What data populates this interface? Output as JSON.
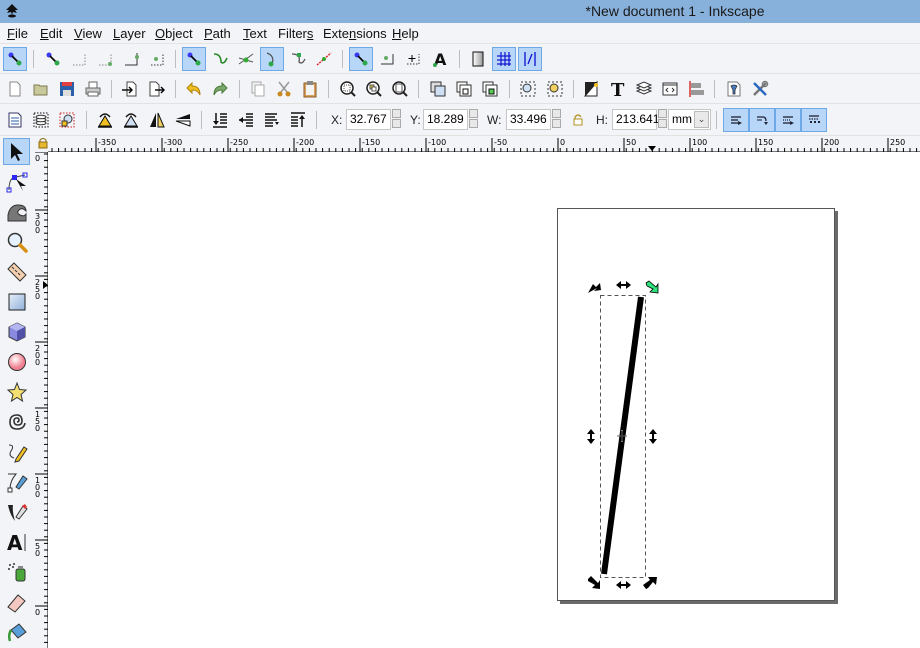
{
  "window": {
    "title": "*New document 1 - Inkscape",
    "app_icon": "inkscape-logo-icon"
  },
  "menu": [
    {
      "label": "File",
      "mnemonic": "F"
    },
    {
      "label": "Edit",
      "mnemonic": "E"
    },
    {
      "label": "View",
      "mnemonic": "V"
    },
    {
      "label": "Layer",
      "mnemonic": "L"
    },
    {
      "label": "Object",
      "mnemonic": "O"
    },
    {
      "label": "Path",
      "mnemonic": "P"
    },
    {
      "label": "Text",
      "mnemonic": "T"
    },
    {
      "label": "Filters",
      "mnemonic": "s"
    },
    {
      "label": "Extensions",
      "mnemonic": "n"
    },
    {
      "label": "Help",
      "mnemonic": "H"
    }
  ],
  "snap_toolbar": {
    "items": [
      {
        "icon": "snap-enable-icon",
        "active": true
      },
      {
        "icon": "snap-bbox-icon",
        "active": false
      },
      {
        "icon": "snap-bbox-edge-icon",
        "active": false
      },
      {
        "icon": "snap-bbox-corner-icon",
        "active": false
      },
      {
        "icon": "snap-bbox-midpoint-icon",
        "active": false
      },
      {
        "icon": "snap-bbox-center-icon",
        "active": false
      },
      {
        "icon": "snap-nodes-icon",
        "active": true
      },
      {
        "icon": "snap-path-icon",
        "active": false
      },
      {
        "icon": "snap-path-intersection-icon",
        "active": false
      },
      {
        "icon": "snap-cusp-nodes-icon",
        "active": true
      },
      {
        "icon": "snap-smooth-nodes-icon",
        "active": false
      },
      {
        "icon": "snap-line-midpoint-icon",
        "active": false
      },
      {
        "icon": "snap-others-icon",
        "active": true
      },
      {
        "icon": "snap-object-center-icon",
        "active": false
      },
      {
        "icon": "snap-rotation-center-icon",
        "active": false
      },
      {
        "icon": "snap-text-baseline-icon",
        "active": false
      },
      {
        "icon": "snap-page-border-icon",
        "active": false
      },
      {
        "icon": "snap-grid-icon",
        "active": true
      },
      {
        "icon": "snap-guide-icon",
        "active": true
      }
    ]
  },
  "commands_toolbar": {
    "items": [
      "new-document-icon",
      "open-icon",
      "save-icon",
      "print-icon",
      "import-icon",
      "export-icon",
      "undo-icon",
      "redo-icon",
      "copy-icon",
      "cut-icon",
      "paste-icon",
      "zoom-selection-icon",
      "zoom-drawing-icon",
      "zoom-page-icon",
      "duplicate-icon",
      "clone-icon",
      "unlink-clone-icon",
      "group-icon",
      "ungroup-icon",
      "fill-stroke-icon",
      "text-font-icon",
      "layers-icon",
      "xml-editor-icon",
      "align-distribute-icon",
      "document-properties-icon",
      "preferences-icon"
    ]
  },
  "select_toolbar": {
    "buttons": [
      "select-all-icon",
      "select-all-layers-icon",
      "deselect-icon",
      "rotate-ccw-icon",
      "rotate-cw-icon",
      "flip-horizontal-icon",
      "flip-vertical-icon",
      "lower-to-bottom-icon",
      "lower-icon",
      "raise-icon",
      "raise-to-top-icon"
    ],
    "x": {
      "label": "X:",
      "value": "32.767"
    },
    "y": {
      "label": "Y:",
      "value": "18.289"
    },
    "w": {
      "label": "W:",
      "value": "33.496"
    },
    "h": {
      "label": "H:",
      "value": "213.641"
    },
    "lock_icon": "lock-icon",
    "unit": "mm",
    "transform_toggles": [
      {
        "icon": "scale-stroke-icon",
        "active": true
      },
      {
        "icon": "scale-corners-icon",
        "active": true
      },
      {
        "icon": "transform-gradients-icon",
        "active": true
      },
      {
        "icon": "transform-patterns-icon",
        "active": true
      }
    ]
  },
  "toolbox": [
    {
      "name": "selector-tool",
      "active": true
    },
    {
      "name": "node-tool",
      "active": false
    },
    {
      "name": "tweak-tool",
      "active": false
    },
    {
      "name": "zoom-tool",
      "active": false
    },
    {
      "name": "measure-tool",
      "active": false
    },
    {
      "name": "rectangle-tool",
      "active": false
    },
    {
      "name": "3d-box-tool",
      "active": false
    },
    {
      "name": "ellipse-tool",
      "active": false
    },
    {
      "name": "star-tool",
      "active": false
    },
    {
      "name": "spiral-tool",
      "active": false
    },
    {
      "name": "pencil-tool",
      "active": false
    },
    {
      "name": "pen-tool",
      "active": false
    },
    {
      "name": "calligraphy-tool",
      "active": false
    },
    {
      "name": "text-tool",
      "active": false
    },
    {
      "name": "spray-tool",
      "active": false
    },
    {
      "name": "eraser-tool",
      "active": false
    },
    {
      "name": "paint-bucket-tool",
      "active": false
    }
  ],
  "hruler": {
    "labels": [
      "-350",
      "-300",
      "-250",
      "-200",
      "-150",
      "-100",
      "-50",
      "0",
      "50",
      "100",
      "150",
      "200",
      "250"
    ]
  },
  "vruler": {
    "labels": [
      "0",
      "300",
      "250",
      "200",
      "150",
      "100",
      "50",
      "0"
    ]
  },
  "canvas": {
    "selection": "line-path",
    "stroke_color": "#000000",
    "rotation_handle_color": "#2ee07a"
  }
}
